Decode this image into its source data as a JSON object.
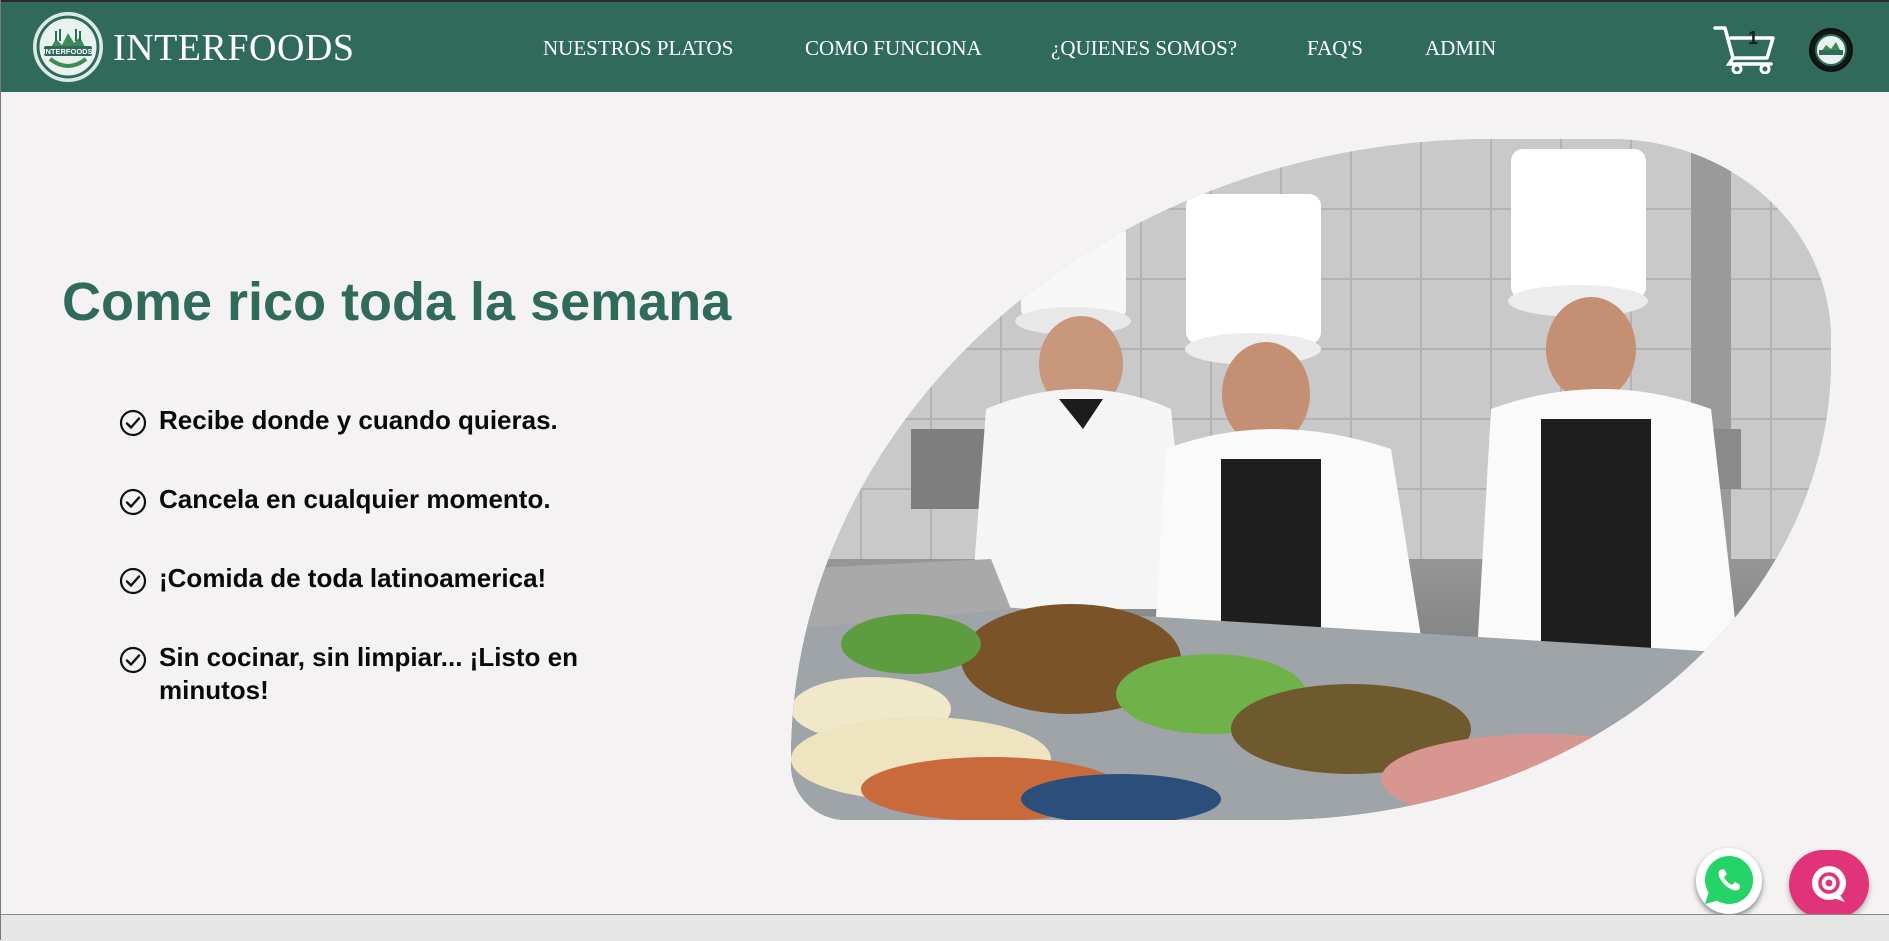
{
  "header": {
    "brand": "INTERFOODS",
    "logo_text": "INTERFOODS",
    "nav": [
      "NUESTROS PLATOS",
      "COMO FUNCIONA",
      "¿QUIENES SOMOS?",
      "FAQ'S",
      "ADMIN"
    ],
    "cart_count": "1"
  },
  "hero": {
    "title": "Come rico toda la semana",
    "features": [
      "Recibe donde y cuando quieras.",
      "Cancela en cualquier momento.",
      "¡Comida de toda latinoamerica!",
      "Sin cocinar, sin limpiar... ¡Listo en minutos!"
    ]
  },
  "colors": {
    "brand_green": "#2f6a5b",
    "page_background": "#f4f2f2",
    "whatsapp_green": "#25d366",
    "chat_pink": "#e1337a"
  },
  "icons": {
    "cart": "shopping-cart-icon",
    "feature_bullet": "check-circle-icon",
    "whatsapp": "whatsapp-icon",
    "chat": "chat-bubble-icon"
  }
}
